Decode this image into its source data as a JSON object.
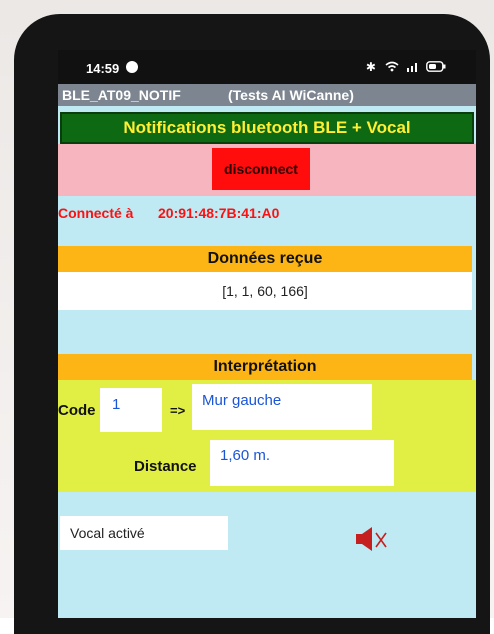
{
  "status_bar": {
    "time": "14:59",
    "icons": [
      "bluetooth-icon",
      "wifi-icon",
      "signal-icon",
      "battery-icon"
    ]
  },
  "title_bar": {
    "app_name": "BLE_AT09_NOTIF",
    "subtitle": "(Tests AI WiCanne)"
  },
  "heading": "Notifications bluetooth BLE + Vocal",
  "connection": {
    "button_label": "disconnect",
    "connected_label": "Connecté à",
    "address": "20:91:48:7B:41:A0"
  },
  "received": {
    "header": "Données reçue",
    "value": "[1, 1, 60, 166]"
  },
  "interpretation": {
    "header": "Interprétation",
    "code_label": "Code",
    "code_value": "1",
    "arrow": "=>",
    "location_value": "Mur gauche",
    "distance_label": "Distance",
    "distance_value": "1,60  m."
  },
  "vocal": {
    "status": "Vocal activé",
    "icon": "speaker-muted-icon"
  },
  "colors": {
    "heading_bg": "#0d6a13",
    "heading_text": "#ffee33",
    "section_orange": "#fdb515",
    "yellow_area": "#e1ef45",
    "light_blue": "#bfe9f3",
    "pink": "#f7b6bf",
    "disconnect_red": "#ff0c0c",
    "value_blue": "#1a55d8"
  }
}
